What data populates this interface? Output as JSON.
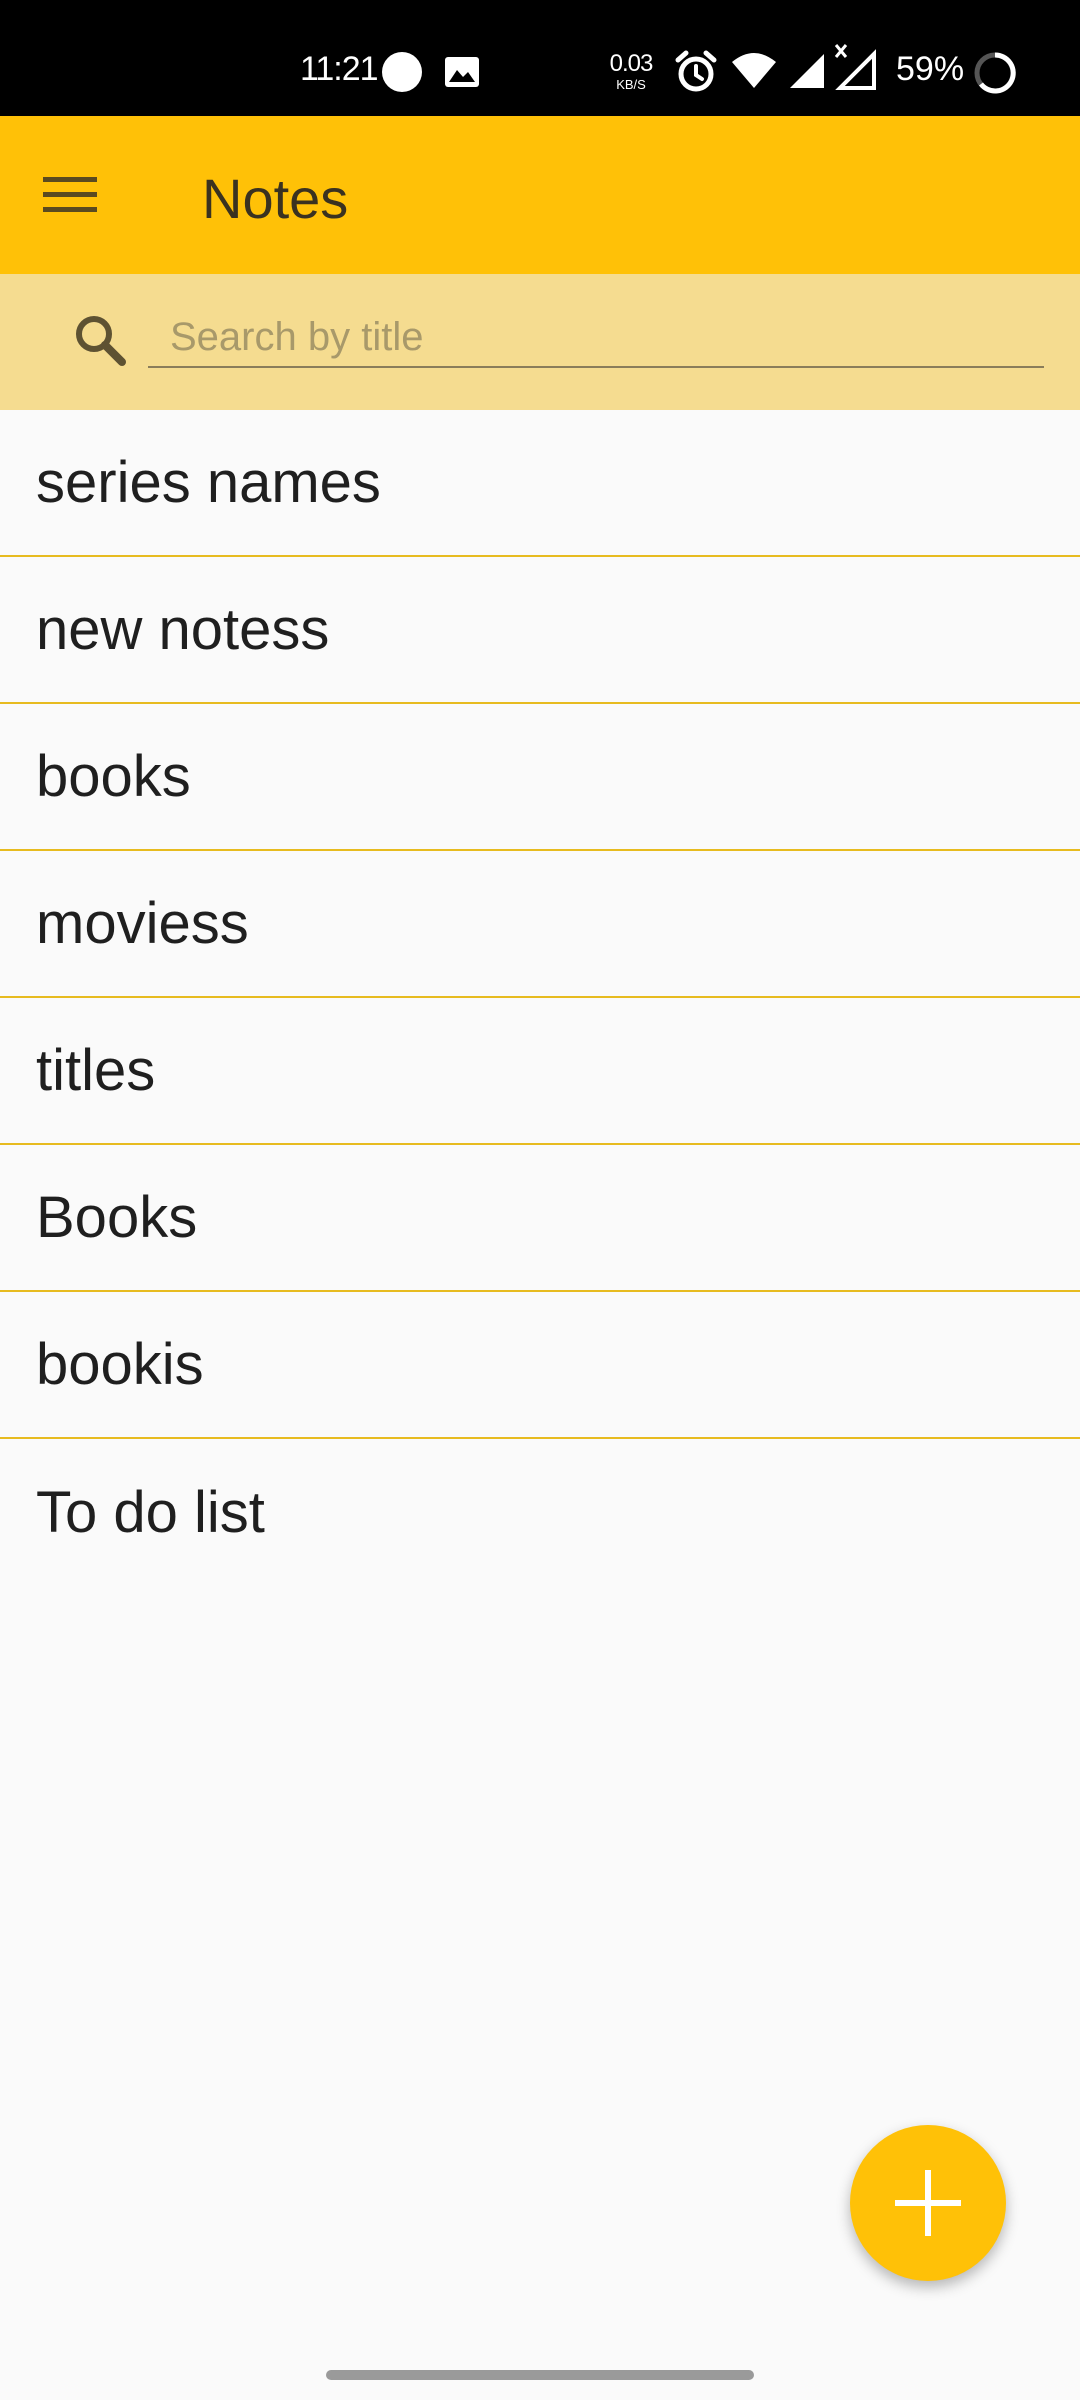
{
  "status_bar": {
    "time": "11:21",
    "net_speed_value": "0.03",
    "net_speed_unit": "KB/S",
    "battery_percent": "59%",
    "icons": [
      "notification-dot-icon",
      "image-icon",
      "alarm-icon",
      "wifi-icon",
      "signal-icon",
      "signal-no-data-icon",
      "battery-icon"
    ]
  },
  "app_bar": {
    "title": "Notes",
    "menu_icon": "hamburger-menu-icon"
  },
  "search": {
    "placeholder": "Search by title",
    "value": "",
    "icon": "search-icon"
  },
  "notes": [
    {
      "title": "series names"
    },
    {
      "title": "new notess"
    },
    {
      "title": "books"
    },
    {
      "title": "moviess"
    },
    {
      "title": "titles"
    },
    {
      "title": "Books"
    },
    {
      "title": "bookis"
    },
    {
      "title": "To do list"
    }
  ],
  "fab": {
    "icon": "plus-icon"
  },
  "colors": {
    "primary": "#ffc107",
    "search_background": "#f5dc90",
    "divider": "#e7bb1f",
    "background": "#fafafa",
    "status_bar": "#000000"
  }
}
